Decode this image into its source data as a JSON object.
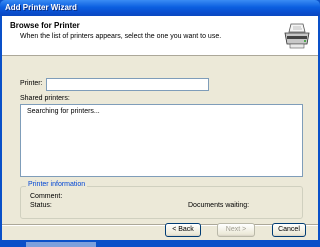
{
  "window": {
    "title": "Add Printer Wizard"
  },
  "header": {
    "title": "Browse for Printer",
    "subtitle": "When the list of printers appears, select the one you want to use.",
    "icon": "printer-icon"
  },
  "form": {
    "printer_label": "Printer:",
    "printer_value": "",
    "shared_label": "Shared printers:",
    "shared_items": [
      "Searching for printers..."
    ]
  },
  "printer_info": {
    "legend": "Printer information",
    "comment_label": "Comment:",
    "status_label": "Status:",
    "documents_label": "Documents waiting:"
  },
  "buttons": {
    "back": "< Back",
    "next": "Next >",
    "cancel": "Cancel"
  },
  "colors": {
    "titlebar": "#0b5fe0",
    "dialog_face": "#ece9d8",
    "group_legend": "#0046d5"
  }
}
